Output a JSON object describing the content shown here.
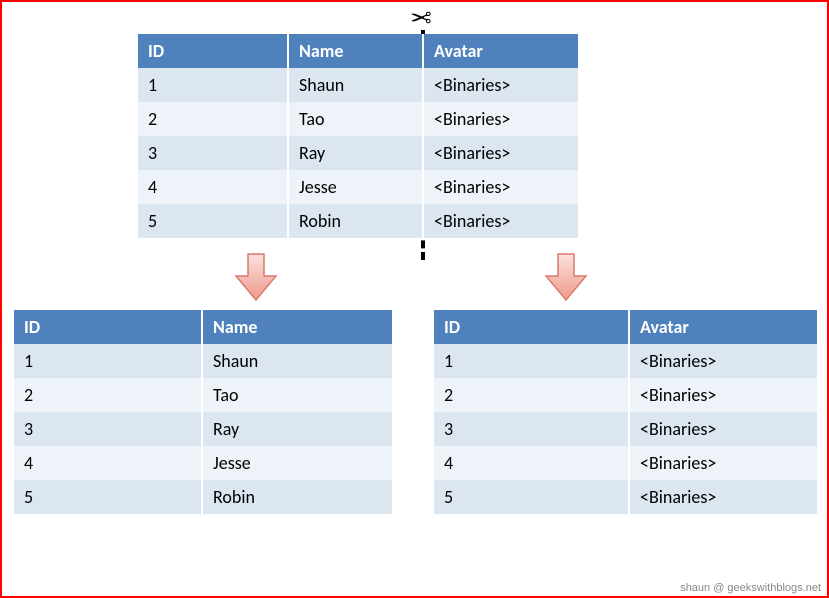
{
  "top_table": {
    "headers": {
      "id": "ID",
      "name": "Name",
      "avatar": "Avatar"
    },
    "rows": [
      {
        "id": "1",
        "name": "Shaun",
        "avatar": "<Binaries>"
      },
      {
        "id": "2",
        "name": "Tao",
        "avatar": "<Binaries>"
      },
      {
        "id": "3",
        "name": "Ray",
        "avatar": "<Binaries>"
      },
      {
        "id": "4",
        "name": "Jesse",
        "avatar": "<Binaries>"
      },
      {
        "id": "5",
        "name": "Robin",
        "avatar": "<Binaries>"
      }
    ]
  },
  "left_table": {
    "headers": {
      "id": "ID",
      "name": "Name"
    },
    "rows": [
      {
        "id": "1",
        "name": "Shaun"
      },
      {
        "id": "2",
        "name": "Tao"
      },
      {
        "id": "3",
        "name": "Ray"
      },
      {
        "id": "4",
        "name": "Jesse"
      },
      {
        "id": "5",
        "name": "Robin"
      }
    ]
  },
  "right_table": {
    "headers": {
      "id": "ID",
      "avatar": "Avatar"
    },
    "rows": [
      {
        "id": "1",
        "avatar": "<Binaries>"
      },
      {
        "id": "2",
        "avatar": "<Binaries>"
      },
      {
        "id": "3",
        "avatar": "<Binaries>"
      },
      {
        "id": "4",
        "avatar": "<Binaries>"
      },
      {
        "id": "5",
        "avatar": "<Binaries>"
      }
    ]
  },
  "icons": {
    "scissors": "✂"
  },
  "colors": {
    "header_bg": "#4f81bd",
    "row_odd": "#dce6f1",
    "row_even": "#eef3f9",
    "arrow_fill": "#f7b8b0",
    "arrow_stroke": "#d97a6c",
    "frame": "#ff0000"
  },
  "attribution": "shaun @ geekswithblogs.net"
}
